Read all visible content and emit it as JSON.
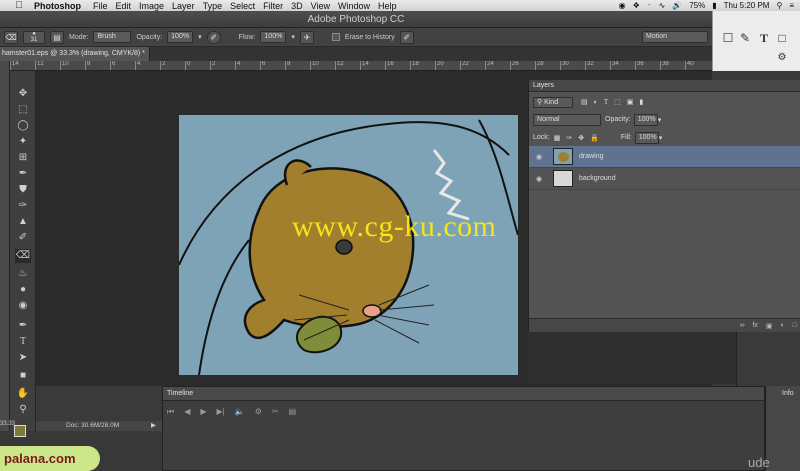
{
  "menubar": {
    "app_name": "Photoshop",
    "items": [
      "File",
      "Edit",
      "Image",
      "Layer",
      "Type",
      "Select",
      "Filter",
      "3D",
      "View",
      "Window",
      "Help"
    ],
    "battery": "75%",
    "clock": "Thu 5:20 PM"
  },
  "window": {
    "title": "Adobe Photoshop CC"
  },
  "options": {
    "brush_size": "31",
    "mode_label": "Mode:",
    "mode_value": "Brush",
    "opacity_label": "Opacity:",
    "opacity_value": "100%",
    "flow_label": "Flow:",
    "flow_value": "100%",
    "erase_history_label": "Erase to History",
    "workspace": "Motion"
  },
  "document": {
    "tab_title": "hamster01.eps @ 33.3% (drawing, CMYK/8) *",
    "ruler_ticks": [
      "14",
      "12",
      "10",
      "8",
      "6",
      "4",
      "2",
      "0",
      "2",
      "4",
      "6",
      "8",
      "10",
      "12",
      "14",
      "16",
      "18",
      "20",
      "22",
      "24",
      "26",
      "28",
      "30",
      "32",
      "34",
      "36",
      "38",
      "40"
    ],
    "doc_size": "Doc: 30.6M/28.0M",
    "zoom": "33.33"
  },
  "layers_panel": {
    "title": "Layers",
    "filter_kind": "Kind",
    "blend_mode": "Normal",
    "opacity_label": "Opacity:",
    "opacity_value": "100%",
    "lock_label": "Lock:",
    "fill_label": "Fill:",
    "fill_value": "100%",
    "layers": [
      {
        "name": "drawing",
        "selected": true
      },
      {
        "name": "background",
        "selected": false
      }
    ]
  },
  "timeline": {
    "title": "Timeline"
  },
  "info_panel": {
    "title": "Info"
  },
  "watermark": {
    "text": "www.cg-ku.com"
  },
  "logos": {
    "left": "palana.com",
    "right": "ude"
  },
  "colors": {
    "canvas_bg": "#7ea3b7",
    "hamster_fill": "#a17f2c",
    "watermark": "#f1e51b",
    "layer_selected": "#5f7391"
  }
}
